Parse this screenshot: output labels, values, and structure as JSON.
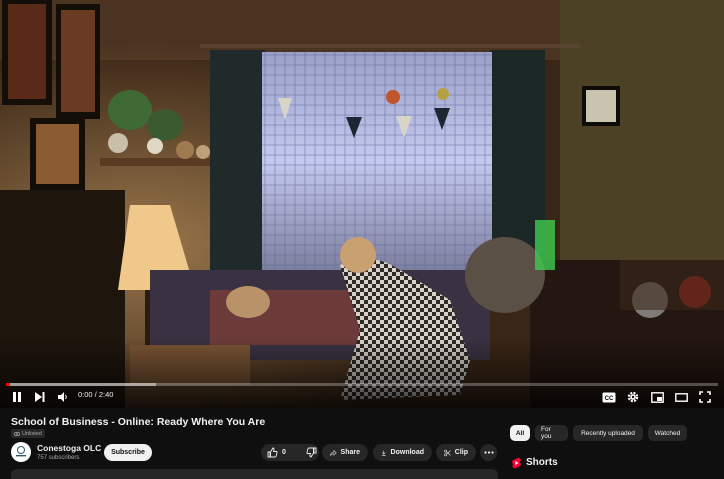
{
  "player": {
    "time_display": "0:00 / 2:40",
    "progress_played": 0.0,
    "progress_buffered": 0.21,
    "controls_left": [
      "play-icon",
      "next-icon",
      "volume-icon"
    ],
    "controls_right": [
      "captions-icon",
      "settings-icon",
      "miniplayer-icon",
      "theater-icon",
      "fullscreen-icon"
    ],
    "captions_label": "CC"
  },
  "video": {
    "title": "School of Business - Online: Ready Where You Are",
    "visibility": "Unlisted"
  },
  "channel": {
    "name": "Conestoga OLC",
    "subscribers": "757 subscribers",
    "subscribe_label": "Subscribe"
  },
  "actions": {
    "like_count": "0",
    "share_label": "Share",
    "download_label": "Download",
    "clip_label": "Clip"
  },
  "chips": [
    "All",
    "For you",
    "Recently uploaded",
    "Watched"
  ],
  "shorts": {
    "label": "Shorts"
  },
  "colors": {
    "accent": "#ff0000",
    "background": "#0f0f0f",
    "surface": "#272727"
  }
}
